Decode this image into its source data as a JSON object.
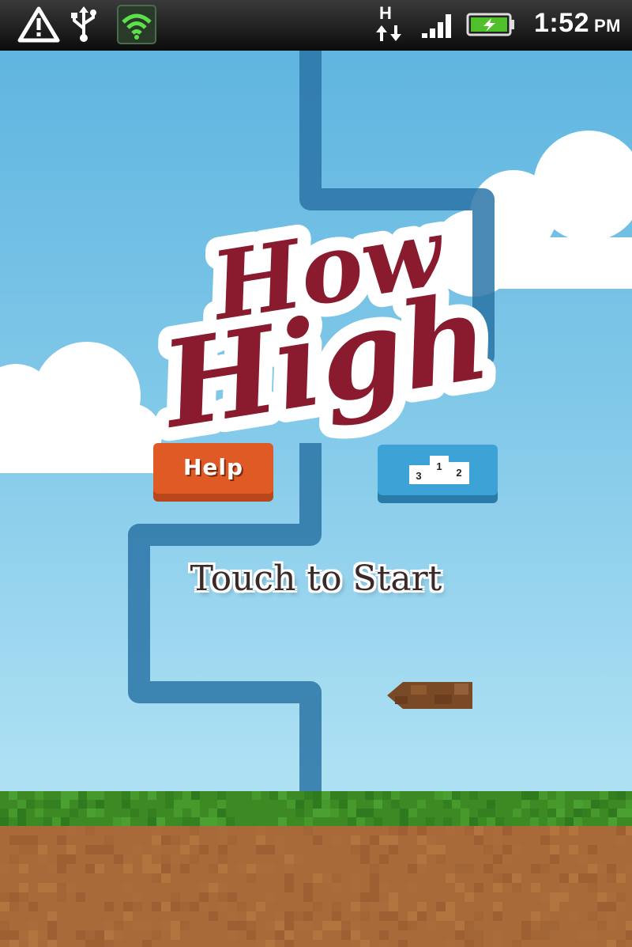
{
  "status_bar": {
    "time": "1:52",
    "ampm": "PM",
    "network_type": "H",
    "icons": [
      "warning-icon",
      "usb-icon",
      "wifi-shield-icon",
      "data-transfer-icon",
      "signal-icon",
      "battery-charging-icon"
    ]
  },
  "game": {
    "title_line1": "How",
    "title_line2": "High",
    "help_label": "Help",
    "leaderboard_icon": "podium-icon",
    "podium_places": [
      "1",
      "2",
      "3"
    ],
    "start_prompt": "Touch to Start"
  },
  "colors": {
    "sky_top": "#5fb5e0",
    "sky_bottom": "#b8e6f6",
    "path": "#3e82ad",
    "help_button": "#e05a26",
    "leaderboard_button": "#3da3d6",
    "title": "#8a1a2e",
    "grass": "#3d8a25",
    "dirt": "#a86a38"
  }
}
